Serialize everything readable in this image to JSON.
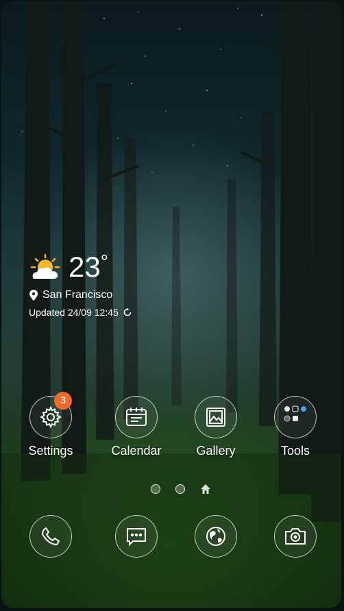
{
  "weather": {
    "temperature": "23",
    "degree": "°",
    "icon": "partly-sunny-icon",
    "location": "San Francisco",
    "updated": "Updated 24/09 12:45"
  },
  "apps": [
    {
      "label": "Settings",
      "icon": "gear-icon",
      "badge": "3"
    },
    {
      "label": "Calendar",
      "icon": "calendar-icon"
    },
    {
      "label": "Gallery",
      "icon": "gallery-icon"
    },
    {
      "label": "Tools",
      "icon": "folder-icon"
    }
  ],
  "page_indicator": {
    "pages": 2,
    "home": "home-icon"
  },
  "dock": [
    {
      "icon": "phone-icon"
    },
    {
      "icon": "messages-icon"
    },
    {
      "icon": "browser-globe-icon"
    },
    {
      "icon": "camera-icon"
    }
  ],
  "colors": {
    "badge": "#f06a2a",
    "sun": "#f5b82a"
  }
}
